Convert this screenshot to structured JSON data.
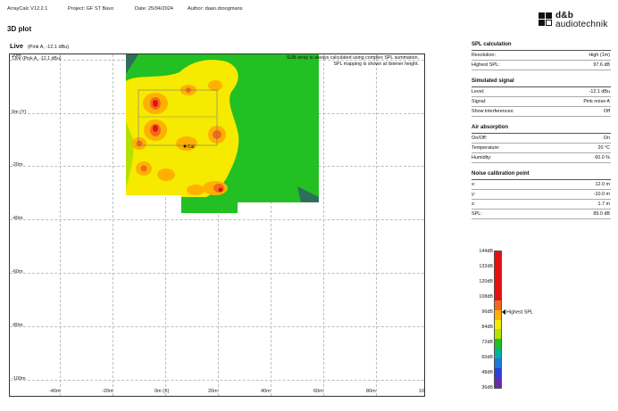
{
  "header": {
    "app_version": "ArrayCalc V12.2.1",
    "project": "Project: GF ST Bavo",
    "date": "Date: 25/04/2024",
    "author": "Author: daan.droogmans"
  },
  "brand": {
    "line1": "d&b",
    "line2": "audiotechnik"
  },
  "page_title": "3D plot",
  "live": {
    "label": "Live",
    "signal": "(Pink A, -12.1 dBu)"
  },
  "plot": {
    "label": "Live   (Pink A, -12.1 dBu)",
    "note1": "SUB array is always calculated using complex SPL summation.",
    "note2": "SPL mapping is shown at listener height.",
    "y_ticks": [
      "20m",
      "0m (Y)",
      "-20m",
      "-40m",
      "-60m",
      "-80m",
      "-100m"
    ],
    "x_ticks": [
      "-40m",
      "-20m",
      "0m (X)",
      "20m",
      "40m",
      "60m",
      "80m",
      "10"
    ],
    "cal_marker": "Cal"
  },
  "panels": [
    {
      "title": "SPL calculation",
      "rows": [
        {
          "label": "Resolution:",
          "value": "High (1m)"
        },
        {
          "label": "Highest SPL:",
          "value": "97.6 dB"
        }
      ]
    },
    {
      "title": "Simulated signal",
      "rows": [
        {
          "label": "Level:",
          "value": "-12.1 dBu"
        },
        {
          "label": "Signal:",
          "value": "Pink noise A"
        },
        {
          "label": "Show interferences:",
          "value": "Off"
        }
      ]
    },
    {
      "title": "Air absorption",
      "rows": [
        {
          "label": "On/Off:",
          "value": "On"
        },
        {
          "label": "Temperature:",
          "value": "20 °C"
        },
        {
          "label": "Humidity:",
          "value": "60.0 %"
        }
      ]
    },
    {
      "title": "Noise calibration point",
      "rows": [
        {
          "label": "x:",
          "value": "12.0 m"
        },
        {
          "label": "y:",
          "value": "-10.0 m"
        },
        {
          "label": "z:",
          "value": "1.7 m"
        },
        {
          "label": "SPL:",
          "value": "89.0 dB"
        }
      ]
    }
  ],
  "legend": {
    "ticks": [
      "144dB",
      "132dB",
      "120dB",
      "108dB",
      "96dB",
      "84dB",
      "72dB",
      "60dB",
      "48dB",
      "36dB"
    ],
    "highest_label": "Highest SPL",
    "colors": [
      "#e61010",
      "#e61010",
      "#e61010",
      "#e61010",
      "#e61010",
      "#f06a1e",
      "#ffb000",
      "#f5ea00",
      "#b6e000",
      "#22c022",
      "#00b0a0",
      "#1a7ad9",
      "#2a40d8",
      "#6a2aa8"
    ]
  }
}
